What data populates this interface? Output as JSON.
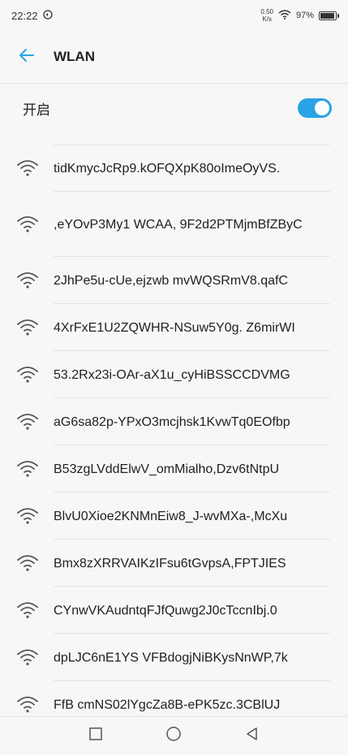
{
  "status": {
    "time": "22:22",
    "speed_value": "0.50",
    "speed_unit": "K/s",
    "battery": "97%",
    "battery_level": 0.97
  },
  "header": {
    "title": "WLAN"
  },
  "toggle": {
    "label": "开启",
    "on": true
  },
  "networks": [
    "tidKmycJcRp9.kOFQXpK80oImeOyVS.",
    ",eYOvP3My1 WCAA, 9F2d2PTMjmBfZByC",
    "2JhPe5u-cUe,ejzwb mvWQSRmV8.qafC",
    "4XrFxE1U2ZQWHR-NSuw5Y0g. Z6mirWI",
    "53.2Rx23i-OAr-aX1u_cyHiBSSCCDVMG",
    "aG6sa82p-YPxO3mcjhsk1KvwTq0EOfbp",
    "B53zgLVddElwV_omMialho,Dzv6tNtpU",
    "BlvU0Xioe2KNMnEiw8_J-wvMXa-,McXu",
    "Bmx8zXRRVAIKzIFsu6tGvpsA,FPTJIES",
    "CYnwVKAudntqFJfQuwg2J0cTccnIbj.0",
    "dpLJC6nE1YS VFBdogjNiBKysNnWP,7k",
    "FfB cmNS02lYgcZa8B-ePK5zc.3CBlUJ"
  ],
  "colors": {
    "accent": "#2aa3e6",
    "text": "#222222",
    "background": "#f7f7f7"
  }
}
